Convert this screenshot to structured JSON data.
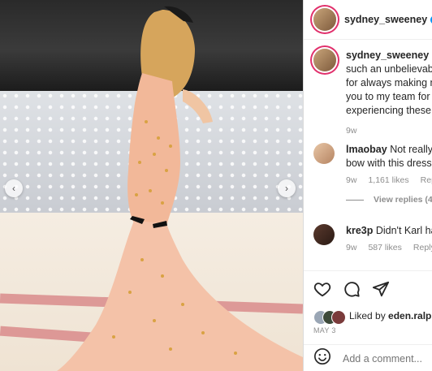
{
  "post": {
    "username": "sydney_sweeney",
    "caption_lines": [
      "such an unbelievable",
      "for always making m",
      "you to my team for e",
      "experiencing these m"
    ],
    "caption_age": "9w"
  },
  "comments": [
    {
      "username": "lmaobay",
      "text_line1": "Not really m",
      "text_line2": "bow with this dress",
      "age": "9w",
      "likes": "1,161 likes",
      "reply": "Reply",
      "view_replies": "View replies (4"
    },
    {
      "username": "kre3p",
      "text_line1": "Didn't Karl hat",
      "age": "9w",
      "likes": "587 likes",
      "reply": "Reply"
    }
  ],
  "likes": {
    "prefix": "Liked by ",
    "user": "eden.ralph"
  },
  "date": "MAY 3",
  "add_comment_placeholder": "Add a comment...",
  "icons": {
    "like": "heart-icon",
    "comment": "comment-icon",
    "share": "send-icon",
    "emoji": "emoji-icon",
    "prev": "chevron-left-icon",
    "next": "chevron-right-icon"
  },
  "colors": {
    "verified": "#0095f6",
    "link_gray": "#8e8e8e"
  }
}
